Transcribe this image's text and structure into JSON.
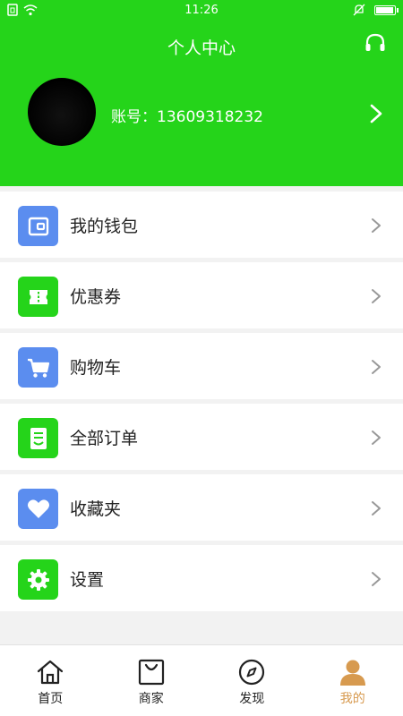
{
  "status_bar": {
    "time": "11:26",
    "battery_level": 0.85
  },
  "header": {
    "title": "个人中心",
    "account_label": "账号：13609318232"
  },
  "menu": [
    {
      "label": "我的钱包",
      "icon": "wallet-icon",
      "color": "#5b8def"
    },
    {
      "label": "优惠券",
      "icon": "coupon-icon",
      "color": "#25d41a"
    },
    {
      "label": "购物车",
      "icon": "cart-icon",
      "color": "#5b8def"
    },
    {
      "label": "全部订单",
      "icon": "order-icon",
      "color": "#25d41a"
    },
    {
      "label": "收藏夹",
      "icon": "heart-icon",
      "color": "#5b8def"
    },
    {
      "label": "设置",
      "icon": "gear-icon",
      "color": "#25d41a"
    }
  ],
  "tabs": [
    {
      "label": "首页",
      "icon": "home-icon"
    },
    {
      "label": "商家",
      "icon": "shopping-bag-icon"
    },
    {
      "label": "发现",
      "icon": "compass-icon"
    },
    {
      "label": "我的",
      "icon": "user-icon",
      "active": true
    }
  ],
  "colors": {
    "primary": "#25d41a",
    "blue": "#5b8def",
    "tab_active": "#d79a4f"
  }
}
